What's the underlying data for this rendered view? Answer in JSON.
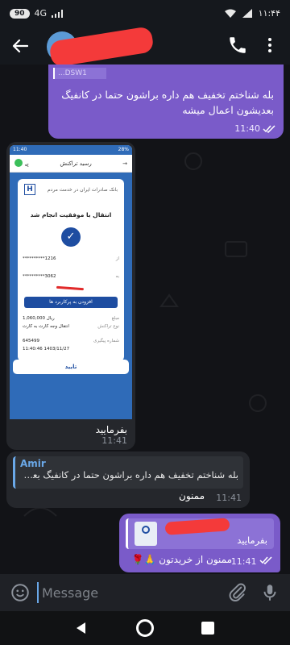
{
  "status_bar": {
    "battery_level": "90",
    "network": "4G",
    "time": "۱۱:۴۴"
  },
  "header": {
    "back_icon": "arrow-left-icon",
    "call_icon": "phone-icon",
    "menu_icon": "more-vertical-icon"
  },
  "messages": {
    "m1": {
      "quote_label": "...DSW1",
      "text": "بله شناختم تخفیف هم داره براشون حتما در کانفیگ بعدیشون اعمال میشه",
      "time": "11:40"
    },
    "m2": {
      "receipt": {
        "time": "11:40",
        "battery": "28%",
        "toolbar_title": "رسید تراکنش",
        "bank_name": "بانک صادرات ایران در خدمت مردم",
        "success_text": "انتقال با موفقیت انجام شد",
        "from_label": "از",
        "from_value": "**********1216",
        "to_label": "به",
        "to_value": "**********3062",
        "favorites_button": "افزودن به پرکاربرد ها",
        "amount_label": "مبلغ",
        "amount_value": "1,060,000 ریال",
        "type_label": "نوع تراکنش",
        "type_value": "انتقال وجه کارت به کارت",
        "tracking_label": "شماره پیگیری",
        "tracking_value": "645499",
        "datetime_value": "11:40:46   1403/11/27",
        "confirm_button": "تایید"
      },
      "caption": "بفرمایید",
      "time": "11:41"
    },
    "m3": {
      "reply_name": "Amir",
      "reply_text": "بله شناختم تخفیف هم داره براشون حتما در کانفیگ بعدی...",
      "text": "ممنون",
      "time": "11:41"
    },
    "m4": {
      "reply_text": "بفرمایید",
      "text": "ممنون از خریدتون 🙏🌹",
      "time": "11:41"
    }
  },
  "composer": {
    "placeholder": "Message",
    "emoji_icon": "emoji-icon",
    "attach_icon": "paperclip-icon",
    "mic_icon": "microphone-icon"
  },
  "colors": {
    "outgoing_bubble": "#7a5bc9",
    "incoming_bubble": "#25272c",
    "accent": "#6aa8e8"
  }
}
